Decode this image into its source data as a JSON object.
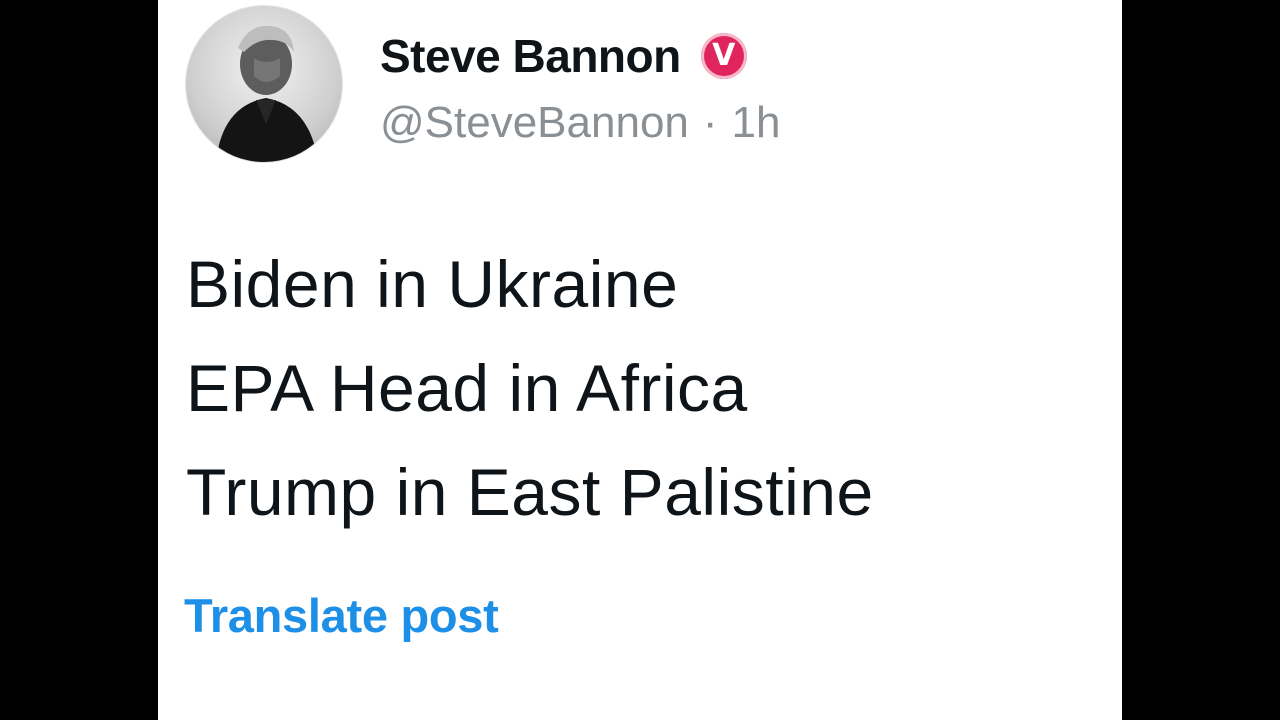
{
  "post": {
    "author": {
      "display_name": "Steve Bannon",
      "handle": "@SteveBannon",
      "badge_letter": "V",
      "badge_color": "#e0245e"
    },
    "separator": "·",
    "timestamp": "1h",
    "lines": [
      "Biden in Ukraine",
      "EPA Head in Africa",
      "Trump in East Palistine"
    ],
    "translate_label": "Translate post",
    "link_color": "#1d8fe6"
  }
}
